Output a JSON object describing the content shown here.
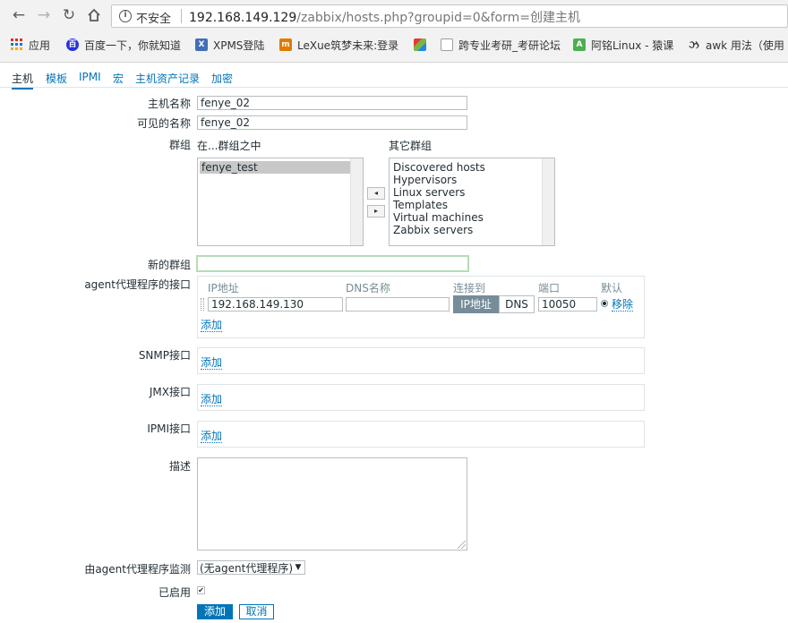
{
  "browser": {
    "security_label": "不安全",
    "url_host": "192.168.149.129",
    "url_path": "/zabbix/hosts.php?groupid=0&form=创建主机",
    "bookmarks": [
      {
        "label": "应用",
        "icon": "apps-grid-icon",
        "color": "#d93025"
      },
      {
        "label": "百度一下，你就知道",
        "icon": "baidu-paw-icon",
        "color": "#2932e1"
      },
      {
        "label": "XPMS登陆",
        "icon": "xpms-icon",
        "color": "#3f6fb6"
      },
      {
        "label": "LeXue筑梦未来:登录",
        "icon": "lexue-icon",
        "color": "#e07b00"
      },
      {
        "label": "",
        "icon": "multicolor-logo-icon",
        "color": "#7cb342"
      },
      {
        "label": "跨专业考研_考研论坛",
        "icon": "page-icon",
        "color": "#9e9e9e"
      },
      {
        "label": "阿铭Linux - 猿课",
        "icon": "aming-icon",
        "color": "#4caf50"
      },
      {
        "label": "awk 用法（使用",
        "icon": "awk-icon",
        "color": "#333333"
      }
    ]
  },
  "tabs": [
    "主机",
    "模板",
    "IPMI",
    "宏",
    "主机资产记录",
    "加密"
  ],
  "form": {
    "host_name_label": "主机名称",
    "host_name_value": "fenye_02",
    "visible_name_label": "可见的名称",
    "visible_name_value": "fenye_02",
    "groups_label": "群组",
    "in_groups_label": "在...群组之中",
    "other_groups_label": "其它群组",
    "in_groups": [
      "fenye_test"
    ],
    "other_groups": [
      "Discovered hosts",
      "Hypervisors",
      "Linux servers",
      "Templates",
      "Virtual machines",
      "Zabbix servers"
    ],
    "move_left_glyph": "◂",
    "move_right_glyph": "▸",
    "new_group_label": "新的群组",
    "new_group_value": "",
    "agent_iface_label": "agent代理程序的接口",
    "iface_headers": {
      "ip": "IP地址",
      "dns": "DNS名称",
      "connect": "连接到",
      "port": "端口",
      "default": "默认"
    },
    "agent_ip": "192.168.149.130",
    "agent_dns": "",
    "connect_ip": "IP地址",
    "connect_dns": "DNS",
    "agent_port": "10050",
    "remove_label": "移除",
    "add_label": "添加",
    "snmp_label": "SNMP接口",
    "jmx_label": "JMX接口",
    "ipmi_label": "IPMI接口",
    "description_label": "描述",
    "description_value": "",
    "proxy_label": "由agent代理程序监测",
    "proxy_value": "(无agent代理程序)",
    "enabled_label": "已启用",
    "submit_label": "添加",
    "cancel_label": "取消"
  }
}
